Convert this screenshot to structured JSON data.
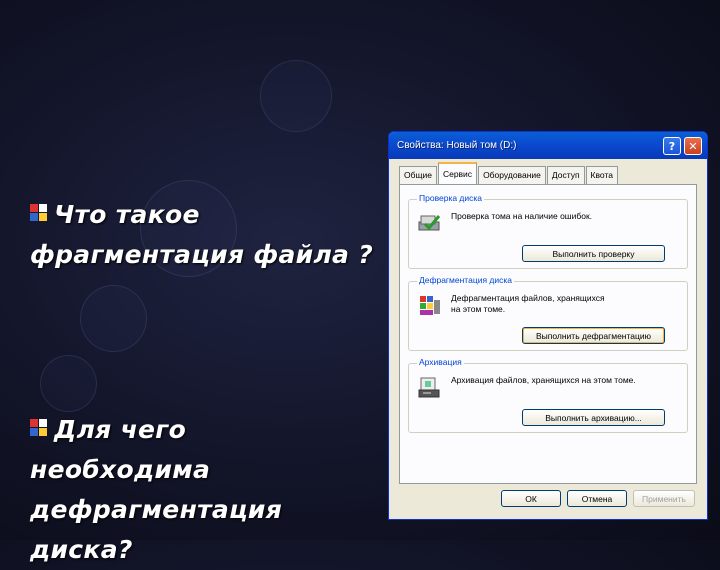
{
  "slide": {
    "bullet1": "Что такое  фрагментация файла ?",
    "bullet2": "Для чего необходима дефрагментация диска?"
  },
  "dialog": {
    "title": "Свойства: Новый том (D:)",
    "tabs": [
      "Общие",
      "Сервис",
      "Оборудование",
      "Доступ",
      "Квота"
    ],
    "active_tab": "Сервис",
    "groups": [
      {
        "title": "Проверка диска",
        "description": "Проверка тома на наличие ошибок.",
        "button": "Выполнить проверку"
      },
      {
        "title": "Дефрагментация диска",
        "description": "Дефрагментация файлов, хранящихся на этом томе.",
        "button": "Выполнить дефрагментацию"
      },
      {
        "title": "Архивация",
        "description": "Архивация файлов, хранящихся на этом томе.",
        "button": "Выполнить архивацию..."
      }
    ],
    "footer_buttons": {
      "ok": "ОК",
      "cancel": "Отмена",
      "apply": "Применить"
    },
    "title_buttons": {
      "help": "?",
      "close": "✕"
    }
  },
  "icons": [
    "windows-flag-icon",
    "check-disk-icon",
    "defrag-icon",
    "backup-icon"
  ],
  "colors": {
    "background": "#121428",
    "title_bar": "#0a4ad0",
    "group_title": "#0046d5",
    "dialog": "#ece9d8"
  }
}
